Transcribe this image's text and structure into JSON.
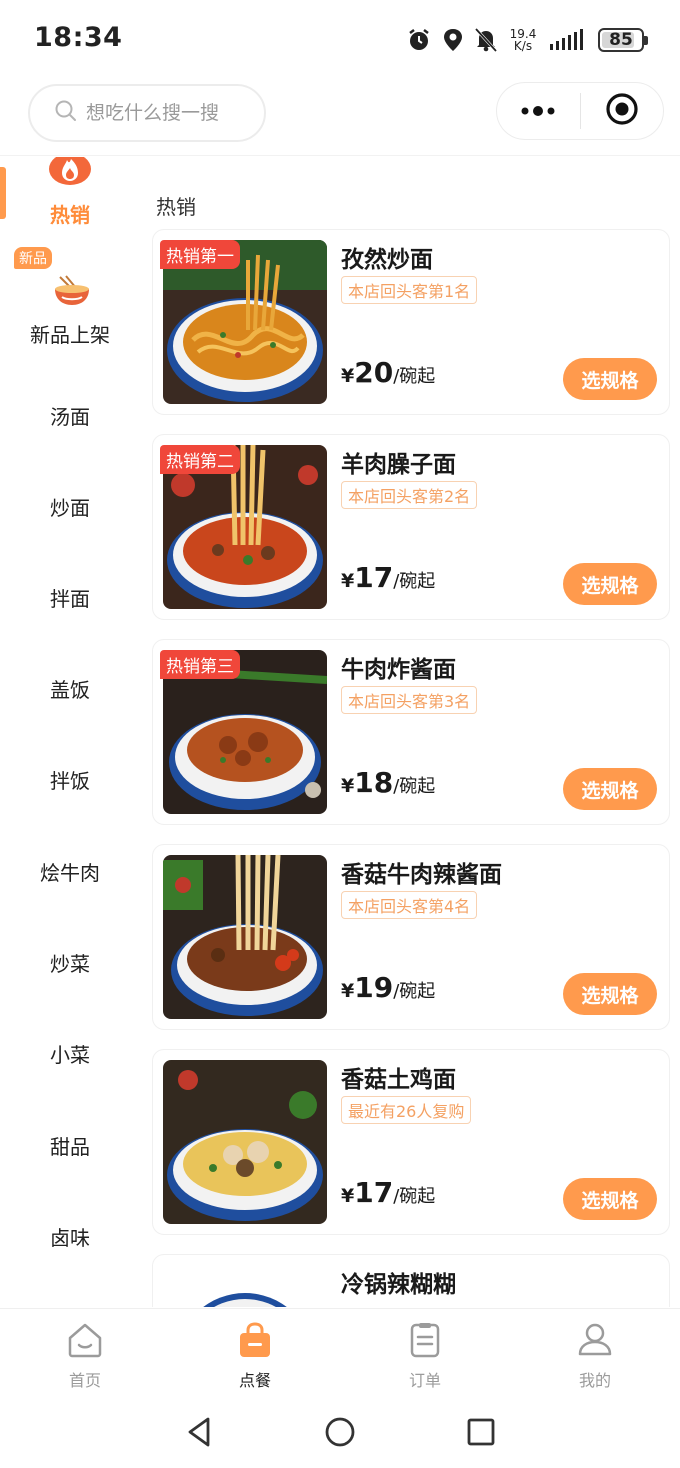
{
  "status": {
    "time": "18:34",
    "net_speed_value": "19.4",
    "net_speed_unit": "K/s",
    "battery": "85",
    "battery_level": 0.85
  },
  "search": {
    "placeholder": "想吃什么搜一搜"
  },
  "sidebar": {
    "items": [
      {
        "label": "热销",
        "active": true
      },
      {
        "label": "新品上架",
        "badge": "新品"
      },
      {
        "label": "汤面"
      },
      {
        "label": "炒面"
      },
      {
        "label": "拌面"
      },
      {
        "label": "盖饭"
      },
      {
        "label": "拌饭"
      },
      {
        "label": "烩牛肉"
      },
      {
        "label": "炒菜"
      },
      {
        "label": "小菜"
      },
      {
        "label": "甜品"
      },
      {
        "label": "卤味"
      }
    ]
  },
  "section": {
    "title": "热销"
  },
  "products": [
    {
      "rank": "热销第一",
      "name": "孜然炒面",
      "tag": "本店回头客第1名",
      "currency": "¥",
      "price": "20",
      "unit": "/碗起",
      "button": "选规格"
    },
    {
      "rank": "热销第二",
      "name": "羊肉臊子面",
      "tag": "本店回头客第2名",
      "currency": "¥",
      "price": "17",
      "unit": "/碗起",
      "button": "选规格"
    },
    {
      "rank": "热销第三",
      "name": "牛肉炸酱面",
      "tag": "本店回头客第3名",
      "currency": "¥",
      "price": "18",
      "unit": "/碗起",
      "button": "选规格"
    },
    {
      "rank": "",
      "name": "香菇牛肉辣酱面",
      "tag": "本店回头客第4名",
      "currency": "¥",
      "price": "19",
      "unit": "/碗起",
      "button": "选规格"
    },
    {
      "rank": "",
      "name": "香菇土鸡面",
      "tag": "最近有26人复购",
      "currency": "¥",
      "price": "17",
      "unit": "/碗起",
      "button": "选规格"
    },
    {
      "rank": "",
      "name": "冷锅辣糊糊",
      "tag": "",
      "currency": "",
      "price": "",
      "unit": "",
      "button": ""
    }
  ],
  "tabs": [
    {
      "label": "首页",
      "icon": "home-icon"
    },
    {
      "label": "点餐",
      "icon": "bag-icon",
      "active": true
    },
    {
      "label": "订单",
      "icon": "order-icon"
    },
    {
      "label": "我的",
      "icon": "profile-icon"
    }
  ],
  "colors": {
    "accent": "#ff9a4d",
    "rank_badge": "#f0473a",
    "tag_text": "#f4a163"
  }
}
